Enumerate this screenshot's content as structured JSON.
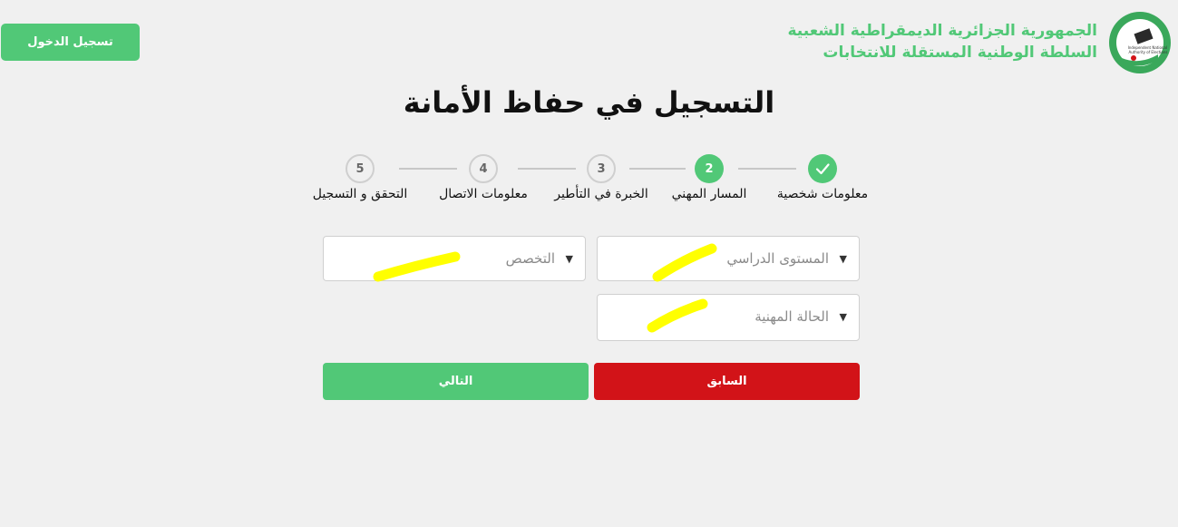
{
  "colors": {
    "accent": "#51c877",
    "danger": "#d21318",
    "highlight": "#ffff00"
  },
  "header": {
    "login_button": "تسجيل الدخول",
    "org_line_1": "الجمهورية الجزائرية الديمقراطية الشعبية",
    "org_line_2": "السلطة الوطنية المستقلة للانتخابات",
    "logo_icon": "ana-ie-logo-icon",
    "logo_text": "Independent National Authority of Elections"
  },
  "title": "التسجيل في حفاظ الأمانة",
  "stepper": {
    "steps": [
      {
        "label": "معلومات شخصية",
        "number": "",
        "state": "done",
        "icon": "checkmark-icon"
      },
      {
        "label": "المسار المهني",
        "number": "2",
        "state": "active"
      },
      {
        "label": "الخبرة في التأطير",
        "number": "3",
        "state": "todo"
      },
      {
        "label": "معلومات الاتصال",
        "number": "4",
        "state": "todo"
      },
      {
        "label": "التحقق و التسجيل",
        "number": "5",
        "state": "todo"
      }
    ]
  },
  "form": {
    "education_level": {
      "placeholder": "المستوى الدراسي",
      "icon": "dropdown-caret-icon"
    },
    "specialty": {
      "placeholder": "التخصص",
      "icon": "dropdown-caret-icon"
    },
    "employment_status": {
      "placeholder": "الحالة المهنية",
      "icon": "dropdown-caret-icon"
    }
  },
  "buttons": {
    "previous": "السابق",
    "next": "التالي"
  }
}
